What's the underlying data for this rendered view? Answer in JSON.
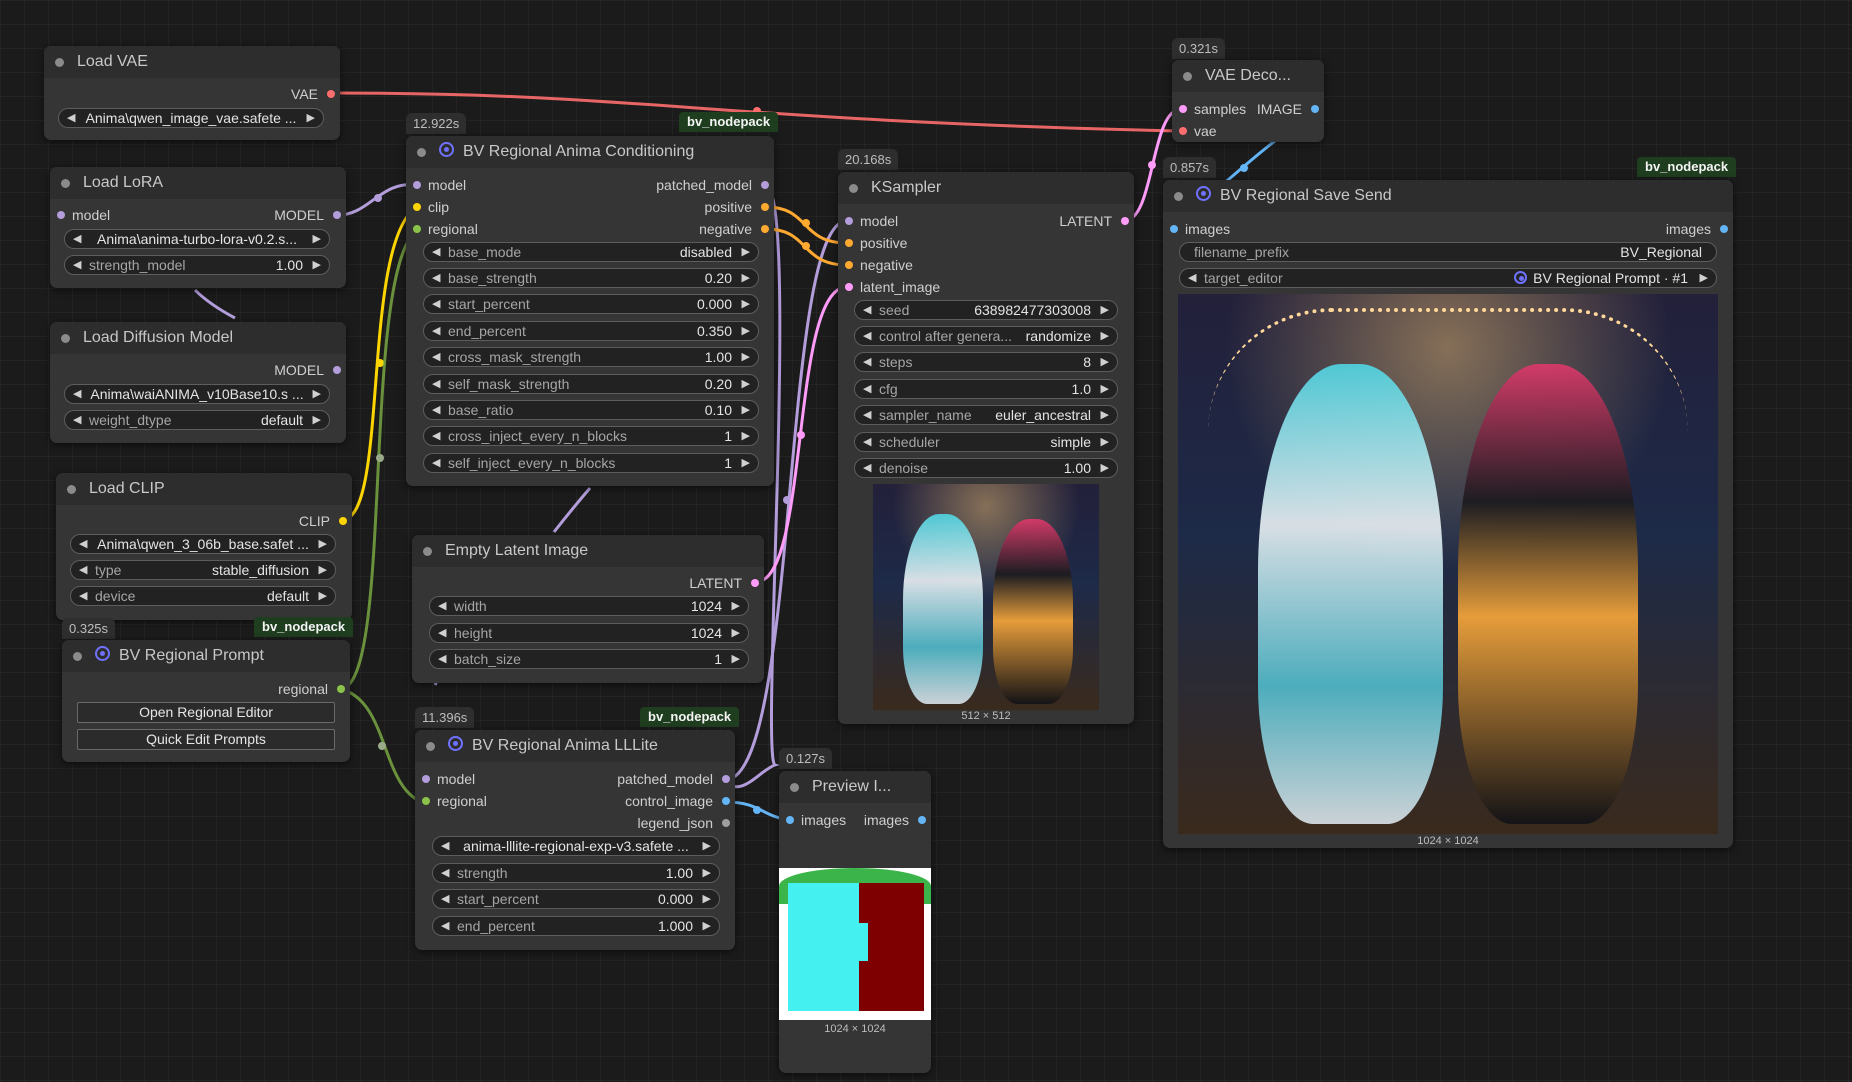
{
  "nodes": {
    "load_vae": {
      "title": "Load VAE",
      "out_label": "VAE",
      "vae_name": "Anima\\qwen_image_vae.safete ..."
    },
    "load_lora": {
      "title": "Load LoRA",
      "in_label": "model",
      "out_label": "MODEL",
      "lora_name": "Anima\\anima-turbo-lora-v0.2.s...",
      "strength_label": "strength_model",
      "strength_value": "1.00"
    },
    "load_diffusion": {
      "title": "Load Diffusion Model",
      "out_label": "MODEL",
      "unet_name": "Anima\\waiANIMA_v10Base10.s ...",
      "dtype_label": "weight_dtype",
      "dtype_value": "default"
    },
    "load_clip": {
      "title": "Load CLIP",
      "out_label": "CLIP",
      "clip_name": "Anima\\qwen_3_06b_base.safet ...",
      "type_label": "type",
      "type_value": "stable_diffusion",
      "device_label": "device",
      "device_value": "default"
    },
    "regional_prompt": {
      "time": "0.325s",
      "badge": "bv_nodepack",
      "title": "BV Regional Prompt",
      "out_label": "regional",
      "btn_editor": "Open Regional Editor",
      "btn_quick": "Quick Edit Prompts"
    },
    "conditioning": {
      "time": "12.922s",
      "badge": "bv_nodepack",
      "title": "BV Regional Anima Conditioning",
      "inputs": [
        "model",
        "clip",
        "regional"
      ],
      "outputs": [
        "patched_model",
        "positive",
        "negative"
      ],
      "widgets": [
        {
          "label": "base_mode",
          "value": "disabled"
        },
        {
          "label": "base_strength",
          "value": "0.20"
        },
        {
          "label": "start_percent",
          "value": "0.000"
        },
        {
          "label": "end_percent",
          "value": "0.350"
        },
        {
          "label": "cross_mask_strength",
          "value": "1.00"
        },
        {
          "label": "self_mask_strength",
          "value": "0.20"
        },
        {
          "label": "base_ratio",
          "value": "0.10"
        },
        {
          "label": "cross_inject_every_n_blocks",
          "value": "1"
        },
        {
          "label": "self_inject_every_n_blocks",
          "value": "1"
        }
      ]
    },
    "empty_latent": {
      "title": "Empty Latent Image",
      "out_label": "LATENT",
      "widgets": [
        {
          "label": "width",
          "value": "1024"
        },
        {
          "label": "height",
          "value": "1024"
        },
        {
          "label": "batch_size",
          "value": "1"
        }
      ]
    },
    "llite": {
      "time": "11.396s",
      "badge": "bv_nodepack",
      "title": "BV Regional Anima LLLite",
      "inputs": [
        "model",
        "regional"
      ],
      "outputs": [
        "patched_model",
        "control_image",
        "legend_json"
      ],
      "model_name": "anima-lllite-regional-exp-v3.safete ...",
      "widgets": [
        {
          "label": "strength",
          "value": "1.00"
        },
        {
          "label": "start_percent",
          "value": "0.000"
        },
        {
          "label": "end_percent",
          "value": "1.000"
        }
      ]
    },
    "ksampler": {
      "time": "20.168s",
      "title": "KSampler",
      "inputs": [
        "model",
        "positive",
        "negative",
        "latent_image"
      ],
      "out_label": "LATENT",
      "widgets": [
        {
          "label": "seed",
          "value": "638982477303008"
        },
        {
          "label": "control after genera...",
          "value": "randomize"
        },
        {
          "label": "steps",
          "value": "8"
        },
        {
          "label": "cfg",
          "value": "1.0"
        },
        {
          "label": "sampler_name",
          "value": "euler_ancestral"
        },
        {
          "label": "scheduler",
          "value": "simple"
        },
        {
          "label": "denoise",
          "value": "1.00"
        }
      ],
      "caption": "512 × 512"
    },
    "vae_decode": {
      "time": "0.321s",
      "title": "VAE Deco...",
      "inputs": [
        "samples",
        "vae"
      ],
      "out_label": "IMAGE"
    },
    "save_send": {
      "time": "0.857s",
      "badge": "bv_nodepack",
      "title": "BV Regional Save Send",
      "in_label": "images",
      "out_label": "images",
      "prefix_label": "filename_prefix",
      "prefix_value": "BV_Regional",
      "editor_label": "target_editor",
      "editor_value": "BV Regional Prompt · #1",
      "caption": "1024 × 1024"
    },
    "preview": {
      "time": "0.127s",
      "title": "Preview I...",
      "in_label": "images",
      "out_label": "images",
      "caption": "1024 × 1024"
    }
  },
  "colors": {
    "model": "#b39ddb",
    "clip": "#ffd500",
    "regional": "#8bc34a",
    "vae": "#ff6e6e",
    "latent": "#ff9cf9",
    "image": "#64b5f6",
    "conditioning": "#ffa931",
    "other": "#9e9e9e"
  }
}
